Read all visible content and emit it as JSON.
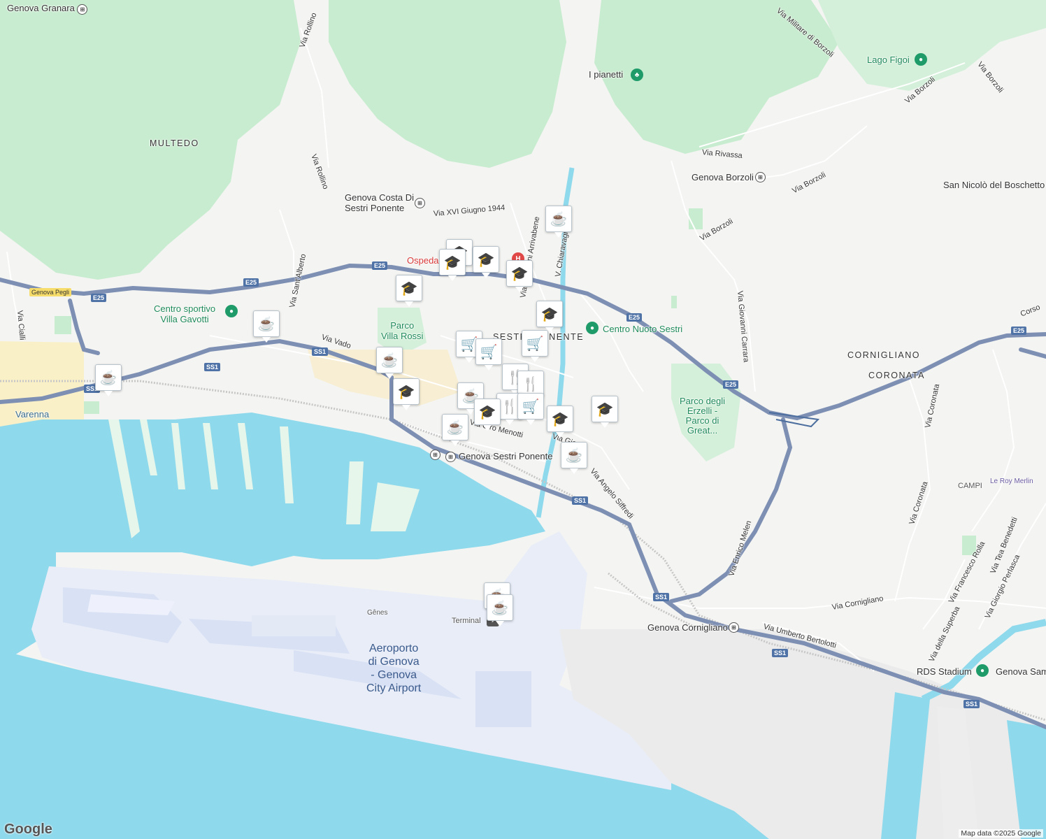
{
  "map": {
    "attribution": "Map data ©2025 Google",
    "logo": "Google",
    "colors": {
      "land": "#f4f4f2",
      "green": "#c8eccf",
      "water": "#8fd9ec",
      "highway": "#7d8fb3",
      "airport": "#e8edf8",
      "marker_icon": "#0c3b5a"
    },
    "areas": {
      "multedo": "MULTEDO",
      "sestri_ponente": "SESTRI PONENTE",
      "cornigliano": "CORNIGLIANO",
      "coronata": "CORONATA",
      "campi": "CAMPI",
      "varenna": "Varenna"
    },
    "places": {
      "genova_granara": "Genova Granara",
      "lago_figoi": "Lago Figoi",
      "i_pianetti": "I pianetti",
      "genova_borzoli": "Genova Borzoli",
      "san_nicolo": "San Nicolò del Boschetto",
      "genova_costa_1": "Genova Costa Di",
      "genova_costa_2": "Sestri Ponente",
      "ospedale": "Ospedale",
      "centro_sportivo_1": "Centro sportivo",
      "centro_sportivo_2": "Villa Gavotti",
      "parco_villa_rossi_1": "Parco",
      "parco_villa_rossi_2": "Villa Rossi",
      "centro_nuoto": "Centro Nuoto Sestri",
      "parco_erzelli_1": "Parco degli",
      "parco_erzelli_2": "Erzelli -",
      "parco_erzelli_3": "Parco di",
      "parco_erzelli_4": "Great...",
      "genova_sestri_ponente": "Genova Sestri Ponente",
      "genova_cornigliano": "Genova Cornigliano",
      "le_roy_merlin": "Le Roy Merlin",
      "rds_stadium": "RDS Stadium",
      "genova_sam": "Genova Sam",
      "genes": "Gênes",
      "terminal": "Terminal",
      "airport_1": "Aeroporto",
      "airport_2": "di Genova",
      "airport_3": "- Genova",
      "airport_4": "City Airport"
    },
    "streets": {
      "via_rollino_1": "Via Rollino",
      "via_rollino_2": "Via Rollino",
      "via_militare": "Via Militare di Borzoli",
      "via_borzoli_1": "Via Borzoli",
      "via_borzoli_2": "Via Borzoli",
      "via_borzoli_3": "Via Borzoli",
      "via_borzoli_4": "Via Borzoli",
      "via_rivassa": "Via Rivassa",
      "via_xvi_giugno": "Via XVI Giugno 1944",
      "via_sant_alberto": "Via Sant'Alberto",
      "via_giovanni_arrivabene": "Via Giovanni Arrivabene",
      "v_chiaravagna": "V. Chiaravagna",
      "via_giovanni_carrara": "Via Giovanni Carrara",
      "via_vado": "Via Vado",
      "via_cialli": "Via Cialli",
      "via_menotti": "Via Ciro Menotti",
      "via_gio": "Via Gio",
      "via_angelo_siffredi": "Via Angelo Siffredi",
      "via_enrico_melen": "Via Enrico Melen",
      "via_coronata_1": "Via Coronata",
      "via_coronata_2": "Via Coronata",
      "via_cornigliano": "Via Cornigliano",
      "via_umberto_bertolotti": "Via Umberto Bertolotti",
      "via_francesco_rolla": "Via Francesco Rolla",
      "via_della_superba": "Via della Superba",
      "via_tea_benedetti": "Via Tea Benedetti",
      "via_giorgio_perlasca": "Via Giorgio Perlasca",
      "corso": "Corso"
    },
    "shields": {
      "genova_pegli": "Genova Pegli",
      "e25_a": "E25",
      "e25_b": "E25",
      "e25_c": "E25",
      "e25_d": "E25",
      "e25_e": "E25",
      "e25_f": "E25",
      "ss1_a": "SS1",
      "ss1_b": "SS1",
      "ss1_c": "SS1",
      "ss1_d": "SS1",
      "ss1_e": "SS1",
      "ss1_f": "SS1",
      "ss1_g": "SS1"
    },
    "markers": [
      {
        "kind": "cafe",
        "glyph": "☕"
      },
      {
        "kind": "school",
        "glyph": "🎓"
      },
      {
        "kind": "school",
        "glyph": "🎓"
      },
      {
        "kind": "school",
        "glyph": "🎓"
      },
      {
        "kind": "school",
        "glyph": "🎓"
      },
      {
        "kind": "school",
        "glyph": "🎓"
      },
      {
        "kind": "school",
        "glyph": "🎓"
      },
      {
        "kind": "cafe",
        "glyph": "☕"
      },
      {
        "kind": "shopping",
        "glyph": "🛒"
      },
      {
        "kind": "shopping",
        "glyph": "🛒"
      },
      {
        "kind": "shopping",
        "glyph": "🛒"
      },
      {
        "kind": "cafe",
        "glyph": "☕"
      },
      {
        "kind": "cafe",
        "glyph": "☕"
      },
      {
        "kind": "school",
        "glyph": "🎓"
      },
      {
        "kind": "restaurant",
        "glyph": "🍴"
      },
      {
        "kind": "restaurant",
        "glyph": "🍴"
      },
      {
        "kind": "cafe",
        "glyph": "☕"
      },
      {
        "kind": "restaurant",
        "glyph": "🍴"
      },
      {
        "kind": "shopping",
        "glyph": "🛒"
      },
      {
        "kind": "school",
        "glyph": "🎓"
      },
      {
        "kind": "school",
        "glyph": "🎓"
      },
      {
        "kind": "school",
        "glyph": "🎓"
      },
      {
        "kind": "cafe",
        "glyph": "☕"
      },
      {
        "kind": "cafe",
        "glyph": "☕"
      },
      {
        "kind": "cafe",
        "glyph": "☕"
      },
      {
        "kind": "cafe",
        "glyph": "☕"
      }
    ]
  }
}
